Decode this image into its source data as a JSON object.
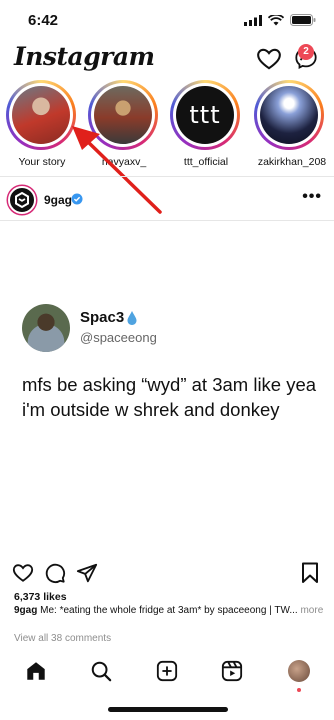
{
  "status_bar": {
    "time": "6:42"
  },
  "header": {
    "logo_text": "Instagram",
    "messages_badge": "2"
  },
  "stories": [
    {
      "label": "Your story"
    },
    {
      "label": "navyaxv_"
    },
    {
      "label": "ttt_official",
      "avatar_text": "ttt"
    },
    {
      "label": "zakirkhan_208"
    }
  ],
  "post": {
    "username": "9gag",
    "more_label": "•••",
    "tweet": {
      "name": "Spac3",
      "handle": "@spaceeong",
      "text": "mfs be asking “wyd” at 3am like yea i'm outside w shrek and donkey"
    },
    "likes": "6,373 likes",
    "caption_user": "9gag",
    "caption_text": "Me: *eating the whole fridge at 3am* by spaceeong | TW...",
    "caption_more": "more",
    "comments_link": "View all 38 comments"
  },
  "colors": {
    "accent_red": "#ed4956",
    "verified_blue": "#3897f0"
  }
}
